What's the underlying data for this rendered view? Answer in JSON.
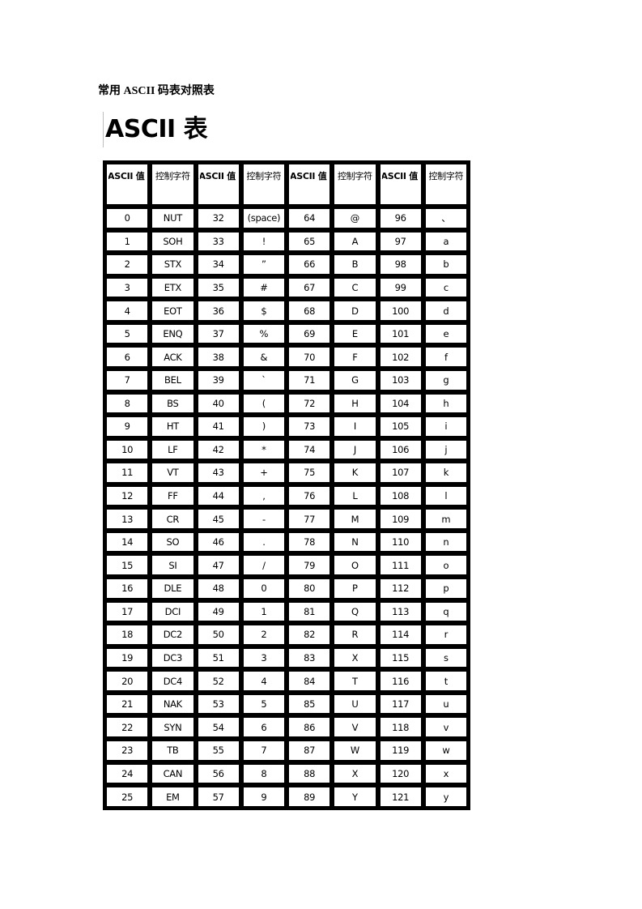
{
  "document": {
    "title": "常用 ASCII 码表对照表",
    "heading": "ASCII 表"
  },
  "table": {
    "headers": [
      "ASCII 值",
      "控制字符",
      "ASCII 值",
      "控制字符",
      "ASCII 值",
      "控制字符",
      "ASCII 值",
      "控制字符"
    ],
    "rows": [
      [
        "0",
        "NUT",
        "32",
        "(space)",
        "64",
        "@",
        "96",
        "、"
      ],
      [
        "1",
        "SOH",
        "33",
        "!",
        "65",
        "A",
        "97",
        "a"
      ],
      [
        "2",
        "STX",
        "34",
        "”",
        "66",
        "B",
        "98",
        "b"
      ],
      [
        "3",
        "ETX",
        "35",
        "#",
        "67",
        "C",
        "99",
        "c"
      ],
      [
        "4",
        "EOT",
        "36",
        "$",
        "68",
        "D",
        "100",
        "d"
      ],
      [
        "5",
        "ENQ",
        "37",
        "%",
        "69",
        "E",
        "101",
        "e"
      ],
      [
        "6",
        "ACK",
        "38",
        "&",
        "70",
        "F",
        "102",
        "f"
      ],
      [
        "7",
        "BEL",
        "39",
        "`",
        "71",
        "G",
        "103",
        "g"
      ],
      [
        "8",
        "BS",
        "40",
        "(",
        "72",
        "H",
        "104",
        "h"
      ],
      [
        "9",
        "HT",
        "41",
        ")",
        "73",
        "I",
        "105",
        "i"
      ],
      [
        "10",
        "LF",
        "42",
        "*",
        "74",
        "J",
        "106",
        "j"
      ],
      [
        "11",
        "VT",
        "43",
        "+",
        "75",
        "K",
        "107",
        "k"
      ],
      [
        "12",
        "FF",
        "44",
        ",",
        "76",
        "L",
        "108",
        "l"
      ],
      [
        "13",
        "CR",
        "45",
        "-",
        "77",
        "M",
        "109",
        "m"
      ],
      [
        "14",
        "SO",
        "46",
        ".",
        "78",
        "N",
        "110",
        "n"
      ],
      [
        "15",
        "SI",
        "47",
        "/",
        "79",
        "O",
        "111",
        "o"
      ],
      [
        "16",
        "DLE",
        "48",
        "0",
        "80",
        "P",
        "112",
        "p"
      ],
      [
        "17",
        "DCI",
        "49",
        "1",
        "81",
        "Q",
        "113",
        "q"
      ],
      [
        "18",
        "DC2",
        "50",
        "2",
        "82",
        "R",
        "114",
        "r"
      ],
      [
        "19",
        "DC3",
        "51",
        "3",
        "83",
        "X",
        "115",
        "s"
      ],
      [
        "20",
        "DC4",
        "52",
        "4",
        "84",
        "T",
        "116",
        "t"
      ],
      [
        "21",
        "NAK",
        "53",
        "5",
        "85",
        "U",
        "117",
        "u"
      ],
      [
        "22",
        "SYN",
        "54",
        "6",
        "86",
        "V",
        "118",
        "v"
      ],
      [
        "23",
        "TB",
        "55",
        "7",
        "87",
        "W",
        "119",
        "w"
      ],
      [
        "24",
        "CAN",
        "56",
        "8",
        "88",
        "X",
        "120",
        "x"
      ],
      [
        "25",
        "EM",
        "57",
        "9",
        "89",
        "Y",
        "121",
        "y"
      ]
    ]
  }
}
